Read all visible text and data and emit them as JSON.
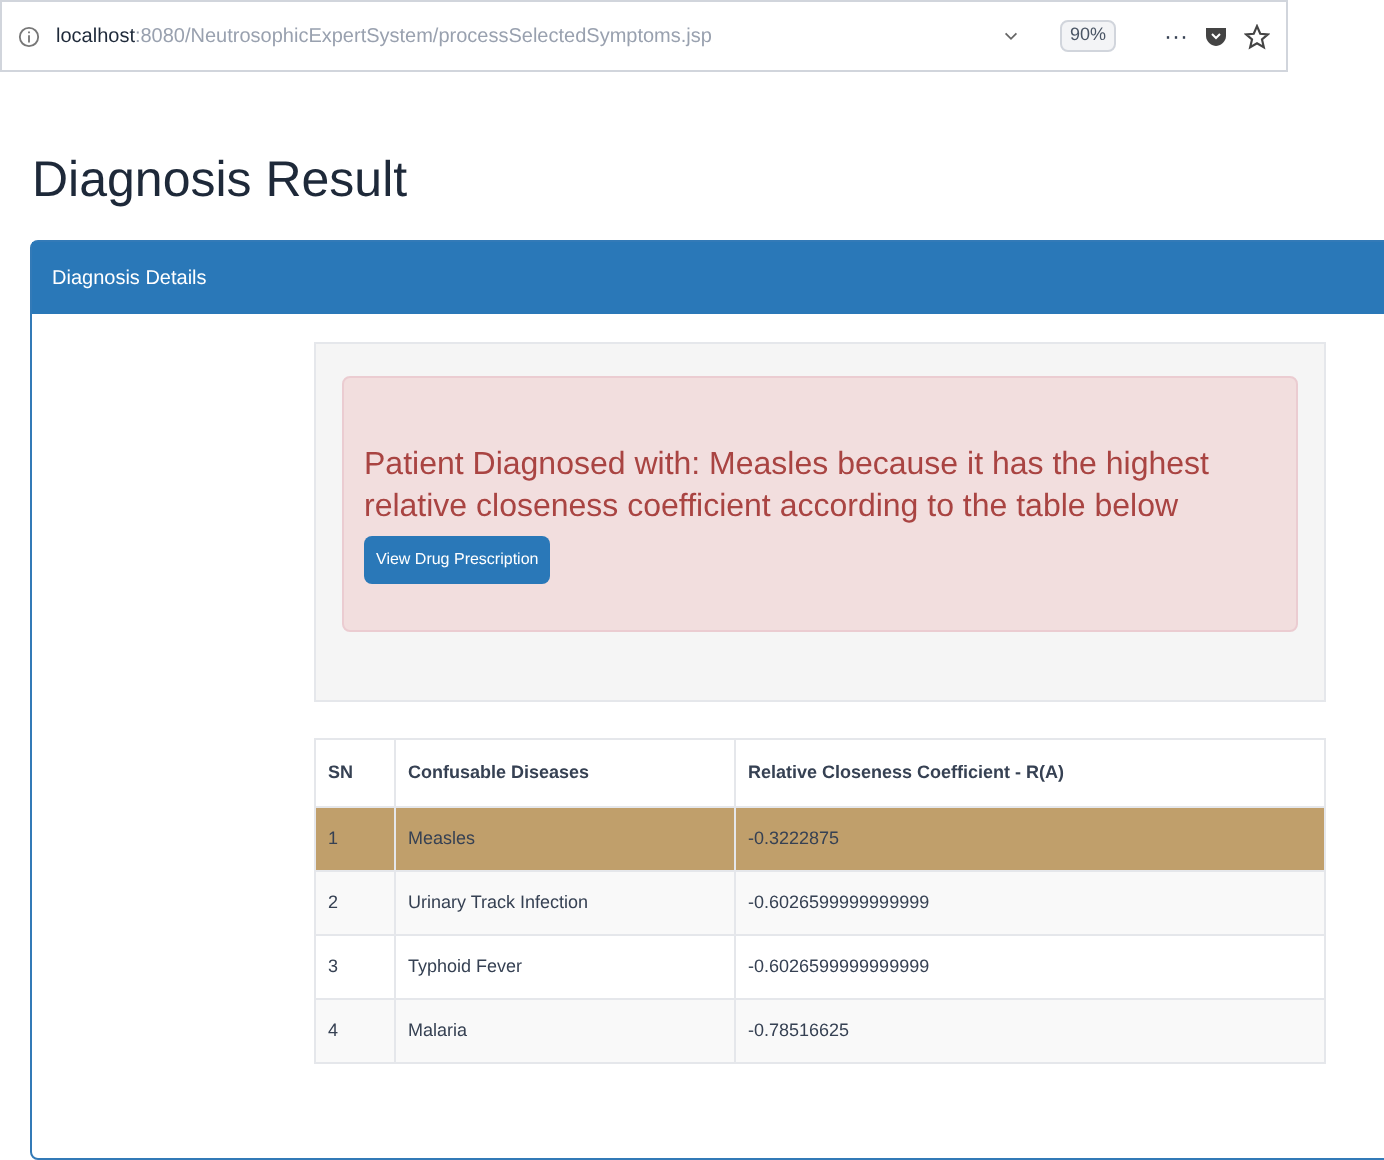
{
  "browser": {
    "host": "localhost",
    "path": ":8080/NeutrosophicExpertSystem/processSelectedSymptoms.jsp",
    "zoom": "90%",
    "more": "···"
  },
  "page_title": "Diagnosis Result",
  "panel": {
    "title": "Diagnosis Details",
    "alert": {
      "message": "Patient Diagnosed with: Measles because it has the highest relative closeness coefficient according to the table below",
      "button": "View Drug Prescription"
    },
    "table": {
      "columns": [
        "SN",
        "Confusable Diseases",
        "Relative Closeness Coefficient - R(A)"
      ],
      "rows": [
        {
          "cells": [
            "1",
            "Measles",
            "-0.3222875"
          ],
          "selected": true
        },
        {
          "cells": [
            "2",
            "Urinary Track Infection",
            "-0.6026599999999999"
          ],
          "selected": false
        },
        {
          "cells": [
            "3",
            "Typhoid Fever",
            "-0.6026599999999999"
          ],
          "selected": false
        },
        {
          "cells": [
            "4",
            "Malaria",
            "-0.78516625"
          ],
          "selected": false
        }
      ]
    }
  }
}
